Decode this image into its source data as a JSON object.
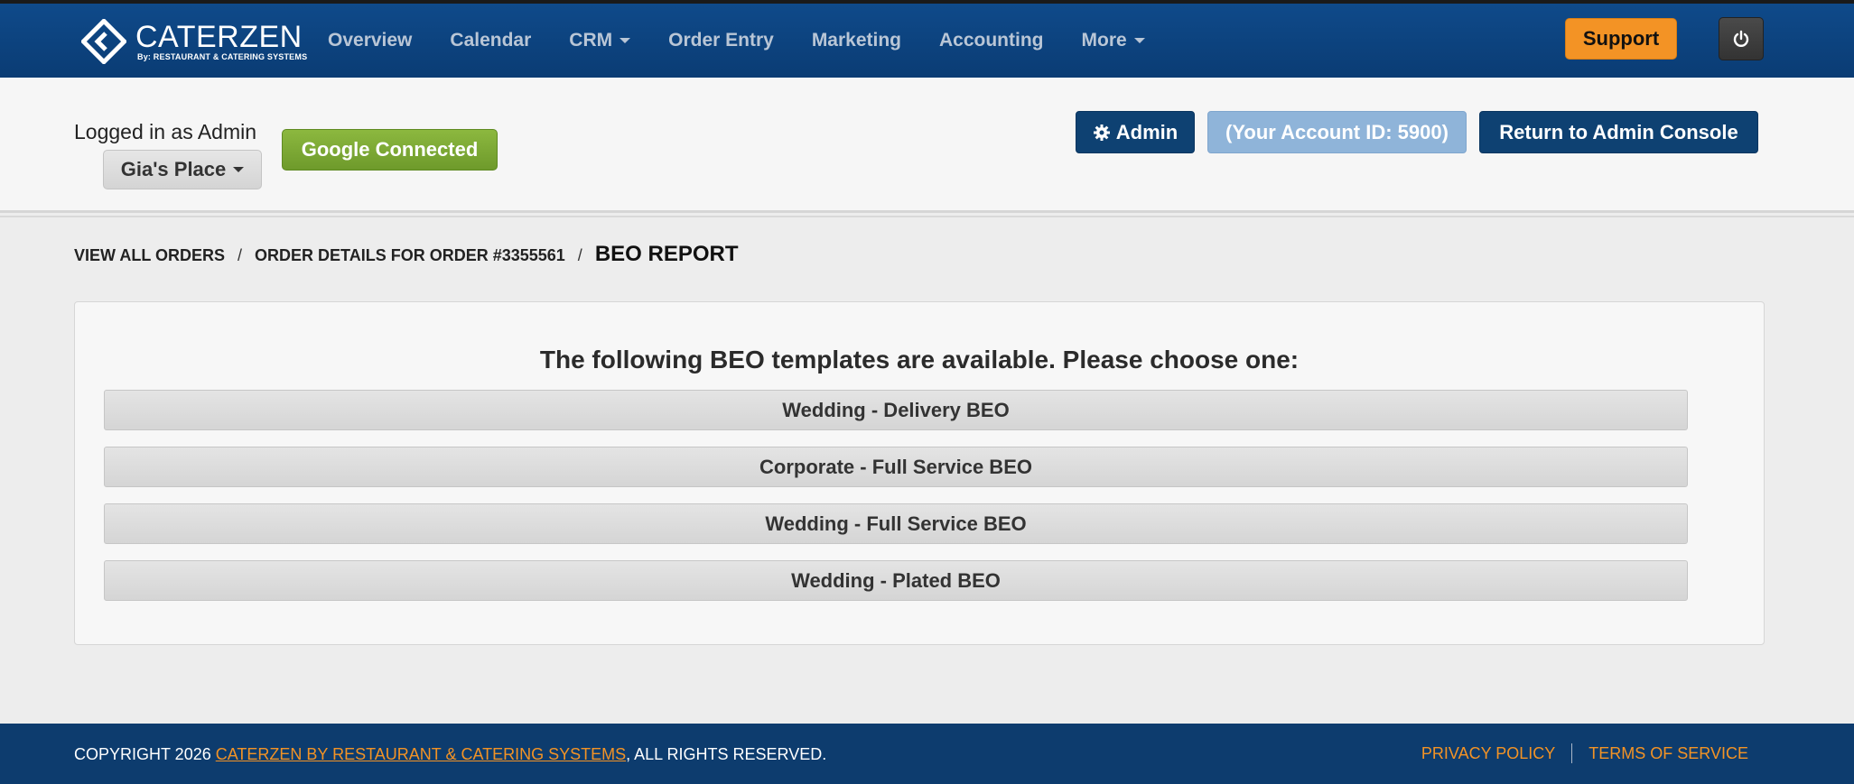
{
  "brand": {
    "name": "CATERZEN",
    "tagline": "By: RESTAURANT & CATERING SYSTEMS"
  },
  "nav": {
    "items": [
      {
        "label": "Overview",
        "dropdown": false
      },
      {
        "label": "Calendar",
        "dropdown": false
      },
      {
        "label": "CRM",
        "dropdown": true
      },
      {
        "label": "Order Entry",
        "dropdown": false
      },
      {
        "label": "Marketing",
        "dropdown": false
      },
      {
        "label": "Accounting",
        "dropdown": false
      },
      {
        "label": "More",
        "dropdown": true
      }
    ],
    "support_label": "Support",
    "power_icon": "power-icon"
  },
  "header": {
    "logged_in_text": "Logged in as Admin",
    "place_label": "Gia's Place",
    "google_label": "Google Connected",
    "admin_label": "Admin",
    "account_label": "(Your Account ID: 5900)",
    "return_label": "Return to Admin Console"
  },
  "breadcrumb": {
    "items": [
      "VIEW ALL ORDERS",
      "ORDER DETAILS FOR ORDER #3355561"
    ],
    "current": "BEO REPORT"
  },
  "panel": {
    "title": "The following BEO templates are available. Please choose one:",
    "templates": [
      "Wedding - Delivery BEO",
      "Corporate - Full Service BEO",
      "Wedding - Full Service BEO",
      "Wedding - Plated BEO"
    ]
  },
  "footer": {
    "copyright_prefix": "COPYRIGHT 2026 ",
    "copyright_link": "CATERZEN BY RESTAURANT & CATERING SYSTEMS",
    "copyright_suffix": ", ALL RIGHTS RESERVED.",
    "privacy_label": "PRIVACY POLICY",
    "terms_label": "TERMS OF SERVICE"
  },
  "colors": {
    "navbar": "#0f4a8a",
    "accent_orange": "#f39325",
    "admin_blue": "#0e4172",
    "google_green": "#7aa833",
    "footer": "#0d3c6e"
  }
}
